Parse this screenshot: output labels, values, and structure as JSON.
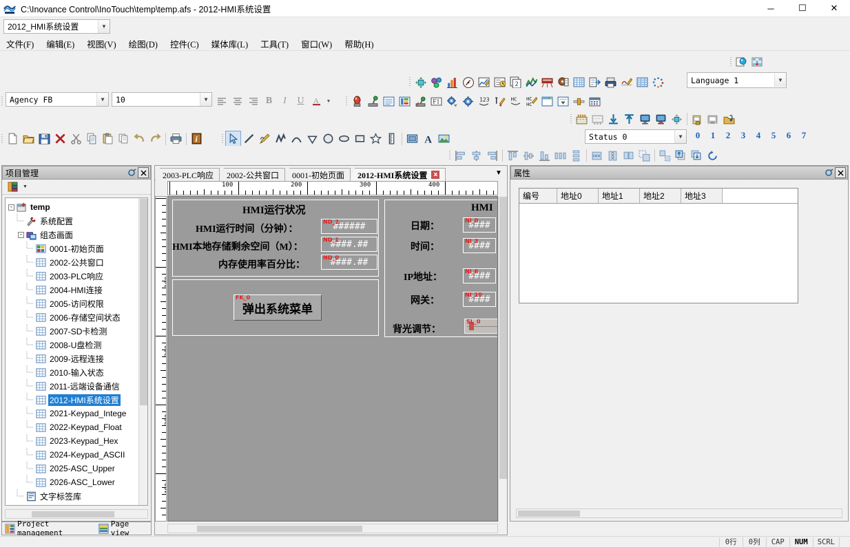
{
  "window": {
    "title": "C:\\Inovance Control\\InoTouch\\temp\\temp.afs - 2012-HMI系统设置",
    "minimize": "─",
    "maximize": "☐",
    "close": "✕"
  },
  "screen_selector": {
    "value": "2012_HMI系统设置"
  },
  "menubar": {
    "items": [
      {
        "label": "文件(F)",
        "name": "menu-file"
      },
      {
        "label": "编辑(E)",
        "name": "menu-edit"
      },
      {
        "label": "视图(V)",
        "name": "menu-view"
      },
      {
        "label": "绘图(D)",
        "name": "menu-draw"
      },
      {
        "label": "控件(C)",
        "name": "menu-control"
      },
      {
        "label": "媒体库(L)",
        "name": "menu-library"
      },
      {
        "label": "工具(T)",
        "name": "menu-tools"
      },
      {
        "label": "窗口(W)",
        "name": "menu-window"
      },
      {
        "label": "帮助(H)",
        "name": "menu-help"
      }
    ]
  },
  "toolbars": {
    "language": {
      "value": "Language 1"
    },
    "font": {
      "value": "Agency FB"
    },
    "font_size": {
      "value": "10"
    },
    "status": {
      "value": "Status 0"
    },
    "status_numbers": [
      "0",
      "1",
      "2",
      "3",
      "4",
      "5",
      "6",
      "7"
    ],
    "row0_icons": [
      "preview-icon",
      "grid-toggle-icon"
    ],
    "row1_icons": [
      "move-widget-icon",
      "multi-state-icon",
      "bar-chart-icon",
      "meter-icon",
      "trend-pen-icon",
      "clock-display-icon",
      "page-number-icon",
      "trend-graph-icon",
      "alarm-banner-icon",
      "recipe-icon",
      "data-table-icon",
      "report-icon",
      "print-icon",
      "signature-icon",
      "sampling-table-icon",
      "animation-icon"
    ],
    "row2_icons": [
      "indicator-lamp-icon",
      "toggle-switch-icon",
      "text-list-icon",
      "bit-lamp-icon",
      "momentary-switch-icon",
      "function-key-icon",
      "settings-bit-icon",
      "settings-word-icon",
      "numeric-input-icon",
      "character-input-icon",
      "hex-input-icon",
      "hex-swap-icon",
      "window-widget-icon",
      "dropdown-list-icon",
      "slider-icon",
      "calendar-icon"
    ],
    "row3_icons": [
      "align-top-edge-icon",
      "align-bottom-edge-icon",
      "import-screen-icon",
      "export-screen-icon",
      "simulate-offline-icon",
      "simulate-online-icon",
      "download-project-icon",
      "compile-icon",
      "save-as-image-icon",
      "open-library-icon"
    ],
    "row4a_icons": [
      "new-file-icon",
      "open-file-icon",
      "save-icon",
      "delete-icon",
      "cut-icon",
      "copy-icon",
      "paste-icon",
      "duplicate-icon",
      "undo-icon",
      "redo-icon",
      "print-doc-icon",
      "properties-info-icon"
    ],
    "row4b_icons": [
      "select-pointer-icon",
      "line-icon",
      "pencil-icon",
      "polyline-icon",
      "arc-icon",
      "polygon-icon",
      "circle-icon",
      "ellipse-icon",
      "rectangle-icon",
      "star-icon",
      "scale-icon",
      "frame-icon",
      "text-icon",
      "picture-icon"
    ],
    "row5_icons": [
      "align-left-icon",
      "align-center-h-icon",
      "align-right-icon",
      "align-top-icon",
      "align-middle-icon",
      "align-bottom-icon",
      "distribute-h-icon",
      "distribute-v-icon",
      "same-width-icon",
      "same-height-icon",
      "same-size-icon",
      "group-icon",
      "ungroup-icon",
      "bring-front-icon",
      "send-back-icon",
      "rotate-icon"
    ]
  },
  "project_panel": {
    "title": "项目管理",
    "tree": [
      {
        "label": "temp",
        "level": 0,
        "icon": "project-icon",
        "expander": "-",
        "bold": true,
        "selected": false
      },
      {
        "label": "系统配置",
        "level": 1,
        "icon": "system-config-icon",
        "expander": "",
        "bold": false,
        "selected": false
      },
      {
        "label": "组态画面",
        "level": 1,
        "icon": "screens-folder-icon",
        "expander": "-",
        "bold": false,
        "selected": false
      },
      {
        "label": "0001-初始页面",
        "level": 2,
        "icon": "screen-home-icon",
        "expander": "",
        "bold": false,
        "selected": false
      },
      {
        "label": "2002-公共窗口",
        "level": 2,
        "icon": "screen-icon",
        "expander": "",
        "bold": false,
        "selected": false
      },
      {
        "label": "2003-PLC响应",
        "level": 2,
        "icon": "screen-icon",
        "expander": "",
        "bold": false,
        "selected": false
      },
      {
        "label": "2004-HMI连接",
        "level": 2,
        "icon": "screen-icon",
        "expander": "",
        "bold": false,
        "selected": false
      },
      {
        "label": "2005-访问权限",
        "level": 2,
        "icon": "screen-icon",
        "expander": "",
        "bold": false,
        "selected": false
      },
      {
        "label": "2006-存储空间状态",
        "level": 2,
        "icon": "screen-icon",
        "expander": "",
        "bold": false,
        "selected": false
      },
      {
        "label": "2007-SD卡检测",
        "level": 2,
        "icon": "screen-icon",
        "expander": "",
        "bold": false,
        "selected": false
      },
      {
        "label": "2008-U盘检测",
        "level": 2,
        "icon": "screen-icon",
        "expander": "",
        "bold": false,
        "selected": false
      },
      {
        "label": "2009-远程连接",
        "level": 2,
        "icon": "screen-icon",
        "expander": "",
        "bold": false,
        "selected": false
      },
      {
        "label": "2010-输入状态",
        "level": 2,
        "icon": "screen-icon",
        "expander": "",
        "bold": false,
        "selected": false
      },
      {
        "label": "2011-远端设备通信",
        "level": 2,
        "icon": "screen-icon",
        "expander": "",
        "bold": false,
        "selected": false
      },
      {
        "label": "2012-HMI系统设置",
        "level": 2,
        "icon": "screen-icon",
        "expander": "",
        "bold": false,
        "selected": true
      },
      {
        "label": "2021-Keypad_Intege",
        "level": 2,
        "icon": "screen-icon",
        "expander": "",
        "bold": false,
        "selected": false
      },
      {
        "label": "2022-Keypad_Float",
        "level": 2,
        "icon": "screen-icon",
        "expander": "",
        "bold": false,
        "selected": false
      },
      {
        "label": "2023-Keypad_Hex",
        "level": 2,
        "icon": "screen-icon",
        "expander": "",
        "bold": false,
        "selected": false
      },
      {
        "label": "2024-Keypad_ASCII",
        "level": 2,
        "icon": "screen-icon",
        "expander": "",
        "bold": false,
        "selected": false
      },
      {
        "label": "2025-ASC_Upper",
        "level": 2,
        "icon": "screen-icon",
        "expander": "",
        "bold": false,
        "selected": false
      },
      {
        "label": "2026-ASC_Lower",
        "level": 2,
        "icon": "screen-icon",
        "expander": "",
        "bold": false,
        "selected": false
      },
      {
        "label": "文字标签库",
        "level": 1,
        "icon": "text-label-library-icon",
        "expander": "",
        "bold": false,
        "selected": false
      }
    ],
    "bottom_tabs": [
      {
        "label": "Project management",
        "name": "tab-project-management"
      },
      {
        "label": "Page view",
        "name": "tab-page-view"
      }
    ]
  },
  "editor": {
    "tabs": [
      {
        "label": "2003-PLC响应",
        "active": false,
        "closable": false
      },
      {
        "label": "2002-公共窗口",
        "active": false,
        "closable": false
      },
      {
        "label": "0001-初始页面",
        "active": false,
        "closable": false
      },
      {
        "label": "2012-HMI系统设置",
        "active": true,
        "closable": true,
        "close_label": "x"
      }
    ],
    "ruler_h_labels": [
      "100",
      "200",
      "300",
      "400"
    ],
    "ruler_v_labels": [
      "100",
      "200",
      "300",
      "400"
    ],
    "canvas": {
      "group_title": "HMI运行状况",
      "right_title": "HMI",
      "labels": [
        {
          "text": "HMI运行时间（分钟）：",
          "tag": ""
        },
        {
          "text": "HMI本地存储剩余空间（M）：",
          "tag": ""
        },
        {
          "text": "内存使用率百分比：",
          "tag": ""
        },
        {
          "text": "日期：",
          "tag": ""
        },
        {
          "text": "时间：",
          "tag": ""
        },
        {
          "text": "IP地址：",
          "tag": ""
        },
        {
          "text": "网关：",
          "tag": ""
        },
        {
          "text": "背光调节：",
          "tag": ""
        }
      ],
      "fields": [
        {
          "tag": "ND_2",
          "value": "######"
        },
        {
          "tag": "ND_1",
          "value": "####.##"
        },
        {
          "tag": "ND_0",
          "value": "####.##"
        },
        {
          "tag": "NI_0",
          "value": "####"
        },
        {
          "tag": "NI_3",
          "value": "####"
        },
        {
          "tag": "NI_6",
          "value": "####"
        },
        {
          "tag": "NI_10",
          "value": "####"
        }
      ],
      "button": {
        "tag": "FK_0",
        "label": "弹出系统菜单"
      },
      "slider": {
        "tag": "SL_0"
      }
    }
  },
  "properties_panel": {
    "title": "属性",
    "columns": [
      "编号",
      "地址0",
      "地址1",
      "地址2",
      "地址3"
    ],
    "rows": []
  },
  "statusbar": {
    "cells": [
      {
        "text": "0行",
        "bold": false
      },
      {
        "text": "0列",
        "bold": false
      },
      {
        "text": "CAP",
        "bold": false
      },
      {
        "text": "NUM",
        "bold": true
      },
      {
        "text": "SCRL",
        "bold": false
      }
    ]
  },
  "colors": {
    "selection_blue": "#1f7fd4",
    "tag_red": "#e02020",
    "canvas_gray": "#9b9b9b",
    "status_number_blue": "#1f5fbf"
  }
}
